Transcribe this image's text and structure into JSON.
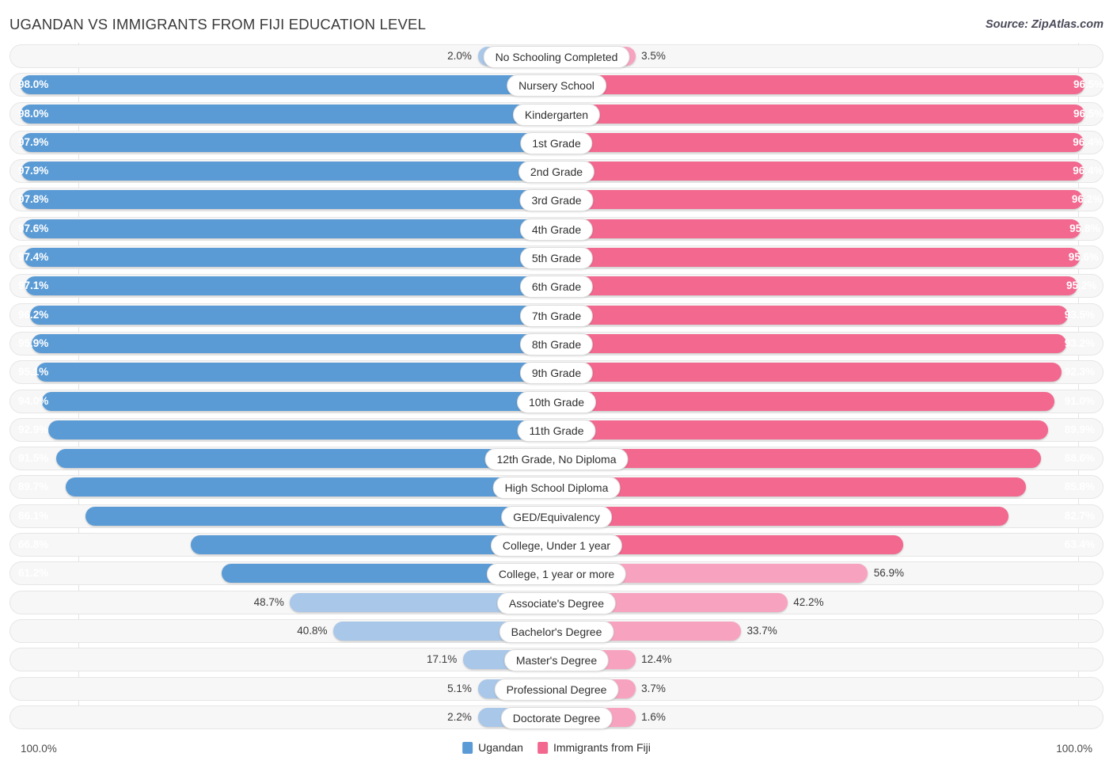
{
  "header": {
    "title": "UGANDAN VS IMMIGRANTS FROM FIJI EDUCATION LEVEL",
    "source": "Source: ZipAtlas.com"
  },
  "legend": {
    "left": {
      "label": "Ugandan",
      "color": "#5b9bd5"
    },
    "right": {
      "label": "Immigrants from Fiji",
      "color": "#f2688f"
    }
  },
  "axis": {
    "left_end": "100.0%",
    "right_end": "100.0%"
  },
  "colors": {
    "left_strong": "#5b9bd5",
    "left_pale": "#a9c7e8",
    "right_strong": "#f2688f",
    "right_pale": "#f7a3c0",
    "track": "#f7f7f7",
    "pill": "#ffffff"
  },
  "chart_data": {
    "type": "bar",
    "subtype": "diverging-horizontal-bar",
    "title": "UGANDAN VS IMMIGRANTS FROM FIJI EDUCATION LEVEL",
    "xlabel": "",
    "ylabel": "",
    "xlim": [
      0,
      100
    ],
    "grid": true,
    "legend_position": "bottom-center",
    "categories": [
      "No Schooling Completed",
      "Nursery School",
      "Kindergarten",
      "1st Grade",
      "2nd Grade",
      "3rd Grade",
      "4th Grade",
      "5th Grade",
      "6th Grade",
      "7th Grade",
      "8th Grade",
      "9th Grade",
      "10th Grade",
      "11th Grade",
      "12th Grade, No Diploma",
      "High School Diploma",
      "GED/Equivalency",
      "College, Under 1 year",
      "College, 1 year or more",
      "Associate's Degree",
      "Bachelor's Degree",
      "Master's Degree",
      "Professional Degree",
      "Doctorate Degree"
    ],
    "series": [
      {
        "name": "Ugandan",
        "color": "#5b9bd5",
        "values": [
          2.0,
          98.0,
          98.0,
          97.9,
          97.9,
          97.8,
          97.6,
          97.4,
          97.1,
          96.2,
          95.9,
          95.1,
          94.0,
          92.9,
          91.5,
          89.7,
          86.1,
          66.8,
          61.2,
          48.7,
          40.8,
          17.1,
          5.1,
          2.2
        ],
        "labels": [
          "2.0%",
          "98.0%",
          "98.0%",
          "97.9%",
          "97.9%",
          "97.8%",
          "97.6%",
          "97.4%",
          "97.1%",
          "96.2%",
          "95.9%",
          "95.1%",
          "94.0%",
          "92.9%",
          "91.5%",
          "89.7%",
          "86.1%",
          "66.8%",
          "61.2%",
          "48.7%",
          "40.8%",
          "17.1%",
          "5.1%",
          "2.2%"
        ]
      },
      {
        "name": "Immigrants from Fiji",
        "color": "#f2688f",
        "values": [
          3.5,
          96.5,
          96.5,
          96.4,
          96.4,
          96.2,
          95.8,
          95.6,
          95.2,
          93.5,
          93.2,
          92.3,
          91.0,
          89.9,
          88.6,
          85.8,
          82.7,
          63.4,
          56.9,
          42.2,
          33.7,
          12.4,
          3.7,
          1.6
        ],
        "labels": [
          "3.5%",
          "96.5%",
          "96.5%",
          "96.4%",
          "96.4%",
          "96.2%",
          "95.8%",
          "95.6%",
          "95.2%",
          "93.5%",
          "93.2%",
          "92.3%",
          "91.0%",
          "89.9%",
          "88.6%",
          "85.8%",
          "82.7%",
          "63.4%",
          "56.9%",
          "42.2%",
          "33.7%",
          "12.4%",
          "3.7%",
          "1.6%"
        ]
      }
    ]
  }
}
